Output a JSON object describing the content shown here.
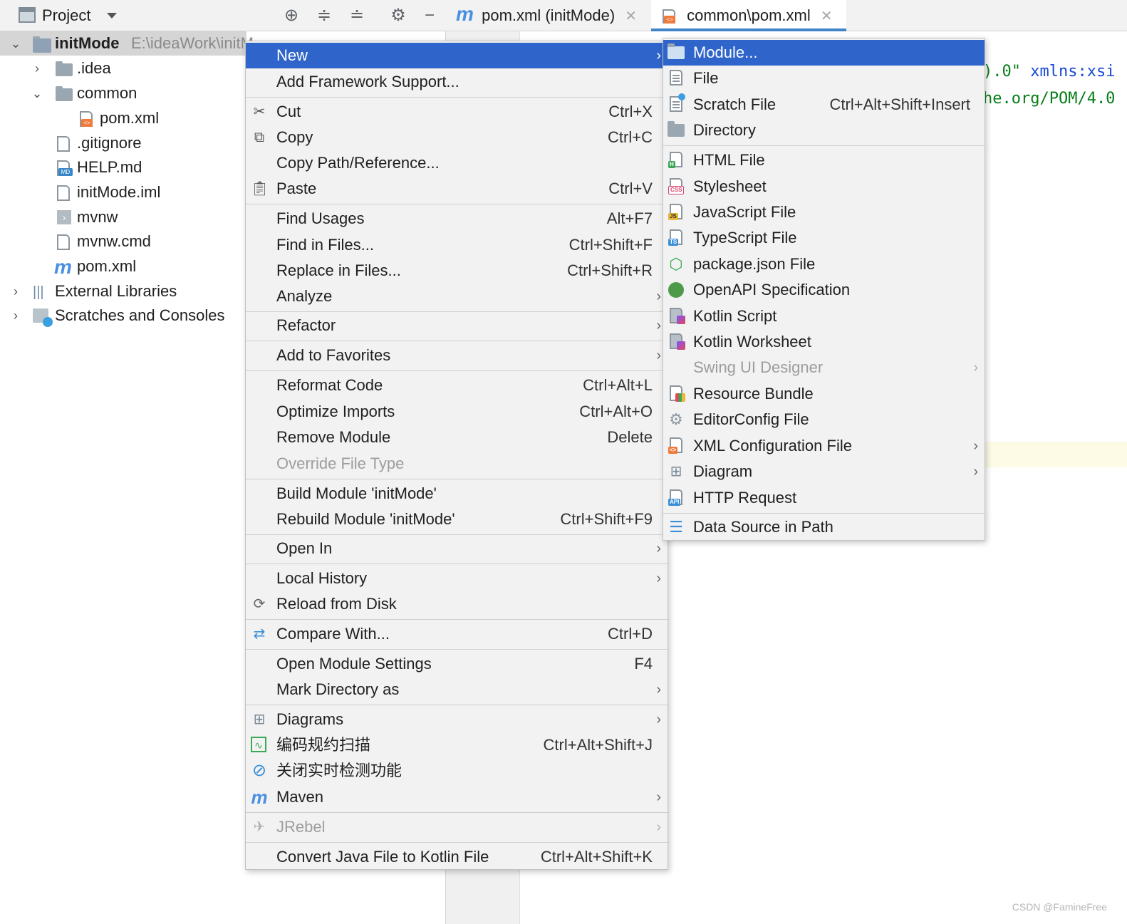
{
  "project_panel": {
    "title": "Project",
    "tree": [
      {
        "label": "initMode",
        "path": "E:\\ideaWork\\initM..."
      },
      {
        "label": ".idea"
      },
      {
        "label": "common"
      },
      {
        "label": "pom.xml"
      },
      {
        "label": ".gitignore"
      },
      {
        "label": "HELP.md"
      },
      {
        "label": "initMode.iml"
      },
      {
        "label": "mvnw"
      },
      {
        "label": "mvnw.cmd"
      },
      {
        "label": "pom.xml"
      },
      {
        "label": "External Libraries"
      },
      {
        "label": "Scratches and Consoles"
      }
    ]
  },
  "editor": {
    "tabs": [
      {
        "label": "pom.xml (initMode)"
      },
      {
        "label": "common\\pom.xml"
      }
    ],
    "code_fragment_1": ").0\" xmlns:xsi",
    "code_fragment_2": "he.org/POM/4.0"
  },
  "context_menu": {
    "items": [
      {
        "label": "New"
      },
      {
        "label": "Add Framework Support..."
      },
      {
        "label": "Cut",
        "shortcut": "Ctrl+X"
      },
      {
        "label": "Copy",
        "shortcut": "Ctrl+C"
      },
      {
        "label": "Copy Path/Reference..."
      },
      {
        "label": "Paste",
        "shortcut": "Ctrl+V"
      },
      {
        "label": "Find Usages",
        "shortcut": "Alt+F7"
      },
      {
        "label": "Find in Files...",
        "shortcut": "Ctrl+Shift+F"
      },
      {
        "label": "Replace in Files...",
        "shortcut": "Ctrl+Shift+R"
      },
      {
        "label": "Analyze"
      },
      {
        "label": "Refactor"
      },
      {
        "label": "Add to Favorites"
      },
      {
        "label": "Reformat Code",
        "shortcut": "Ctrl+Alt+L"
      },
      {
        "label": "Optimize Imports",
        "shortcut": "Ctrl+Alt+O"
      },
      {
        "label": "Remove Module",
        "shortcut": "Delete"
      },
      {
        "label": "Override File Type"
      },
      {
        "label": "Build Module 'initMode'"
      },
      {
        "label": "Rebuild Module 'initMode'",
        "shortcut": "Ctrl+Shift+F9"
      },
      {
        "label": "Open In"
      },
      {
        "label": "Local History"
      },
      {
        "label": "Reload from Disk"
      },
      {
        "label": "Compare With...",
        "shortcut": "Ctrl+D"
      },
      {
        "label": "Open Module Settings",
        "shortcut": "F4"
      },
      {
        "label": "Mark Directory as"
      },
      {
        "label": "Diagrams"
      },
      {
        "label": "编码规约扫描",
        "shortcut": "Ctrl+Alt+Shift+J"
      },
      {
        "label": "关闭实时检测功能"
      },
      {
        "label": "Maven"
      },
      {
        "label": "JRebel"
      },
      {
        "label": "Convert Java File to Kotlin File",
        "shortcut": "Ctrl+Alt+Shift+K"
      }
    ]
  },
  "new_submenu": {
    "items": [
      {
        "label": "Module..."
      },
      {
        "label": "File"
      },
      {
        "label": "Scratch File",
        "shortcut": "Ctrl+Alt+Shift+Insert"
      },
      {
        "label": "Directory"
      },
      {
        "label": "HTML File"
      },
      {
        "label": "Stylesheet"
      },
      {
        "label": "JavaScript File"
      },
      {
        "label": "TypeScript File"
      },
      {
        "label": "package.json File"
      },
      {
        "label": "OpenAPI Specification"
      },
      {
        "label": "Kotlin Script"
      },
      {
        "label": "Kotlin Worksheet"
      },
      {
        "label": "Swing UI Designer"
      },
      {
        "label": "Resource Bundle"
      },
      {
        "label": "EditorConfig File"
      },
      {
        "label": "XML Configuration File"
      },
      {
        "label": "Diagram"
      },
      {
        "label": "HTTP Request"
      },
      {
        "label": "Data Source in Path"
      }
    ]
  },
  "watermark": "CSDN @FamineFree",
  "colors": {
    "highlight": "#2f65ca",
    "menu_bg": "#f2f2f2",
    "tab_underline": "#4083c9",
    "xml_badge": "#f07a3c",
    "maven_blue": "#4a90e2"
  }
}
